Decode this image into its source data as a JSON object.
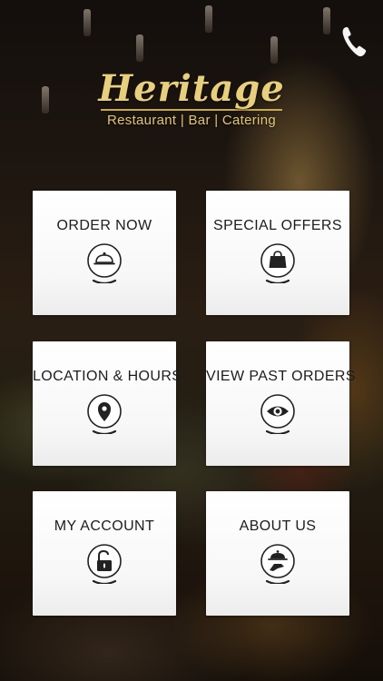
{
  "brand": {
    "title": "Heritage",
    "subtitle": "Restaurant | Bar | Catering",
    "accent_color": "#e8cf7e"
  },
  "header": {
    "call_icon": "phone-icon"
  },
  "menu": {
    "order_now": {
      "label": "ORDER NOW",
      "icon": "cloche-icon"
    },
    "special_offers": {
      "label": "SPECIAL OFFERS",
      "icon": "shopping-bag-icon"
    },
    "location_hours": {
      "label": "LOCATION & HOURS",
      "icon": "map-pin-icon"
    },
    "view_past_orders": {
      "label": "VIEW PAST ORDERS",
      "icon": "eye-icon"
    },
    "my_account": {
      "label": "MY ACCOUNT",
      "icon": "unlock-icon"
    },
    "about_us": {
      "label": "ABOUT US",
      "icon": "waiter-icon"
    }
  }
}
